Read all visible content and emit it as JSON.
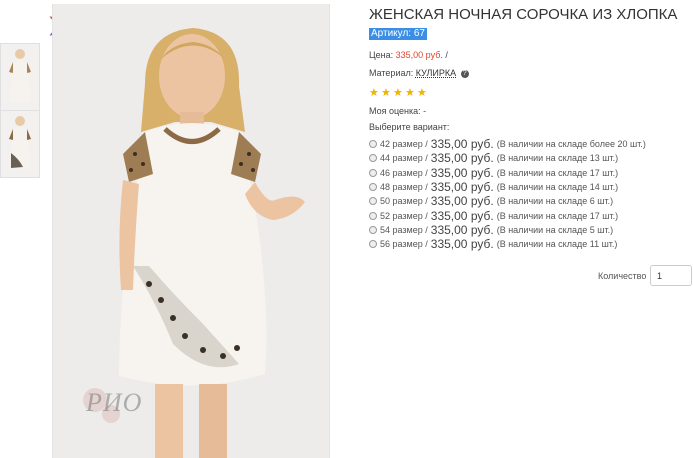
{
  "product": {
    "title": "ЖЕНСКАЯ НОЧНАЯ СОРОЧКА ИЗ ХЛОПКА",
    "sku": "Артикул: 67",
    "price_label": "Цена:",
    "price_value": "335,00 руб.",
    "price_sep": "/",
    "material_label": "Материал:",
    "material_value": "КУЛИРКА",
    "rating_value": 5,
    "my_rating": "Моя оценка: -",
    "choose_variant": "Выберите вариант:",
    "variants": [
      {
        "size": "42 размер",
        "sep": "/",
        "price": "335,00 руб.",
        "stock": "(В наличии на складе более 20 шт.)"
      },
      {
        "size": "44 размер",
        "sep": "/",
        "price": "335,00 руб.",
        "stock": "(В наличии на складе 13 шт.)"
      },
      {
        "size": "46 размер",
        "sep": "/",
        "price": "335,00 руб.",
        "stock": "(В наличии на складе 17 шт.)"
      },
      {
        "size": "48 размер",
        "sep": "/",
        "price": "335,00 руб.",
        "stock": "(В наличии на складе 14 шт.)"
      },
      {
        "size": "50 размер",
        "sep": "/",
        "price": "335,00 руб.",
        "stock": "(В наличии на складе 6 шт.)"
      },
      {
        "size": "52 размер",
        "sep": "/",
        "price": "335,00 руб.",
        "stock": "(В наличии на складе 17 шт.)"
      },
      {
        "size": "54 размер",
        "sep": "/",
        "price": "335,00 руб.",
        "stock": "(В наличии на складе 5 шт.)"
      },
      {
        "size": "56 размер",
        "sep": "/",
        "price": "335,00 руб.",
        "stock": "(В наличии на складе 11 шт.)"
      }
    ],
    "quantity_label": "Количество",
    "quantity_value": "1"
  },
  "watermark": "РИО",
  "colors": {
    "price": "#e0462c",
    "sku_bg": "#3a8ee6",
    "star": "#f0b300"
  }
}
